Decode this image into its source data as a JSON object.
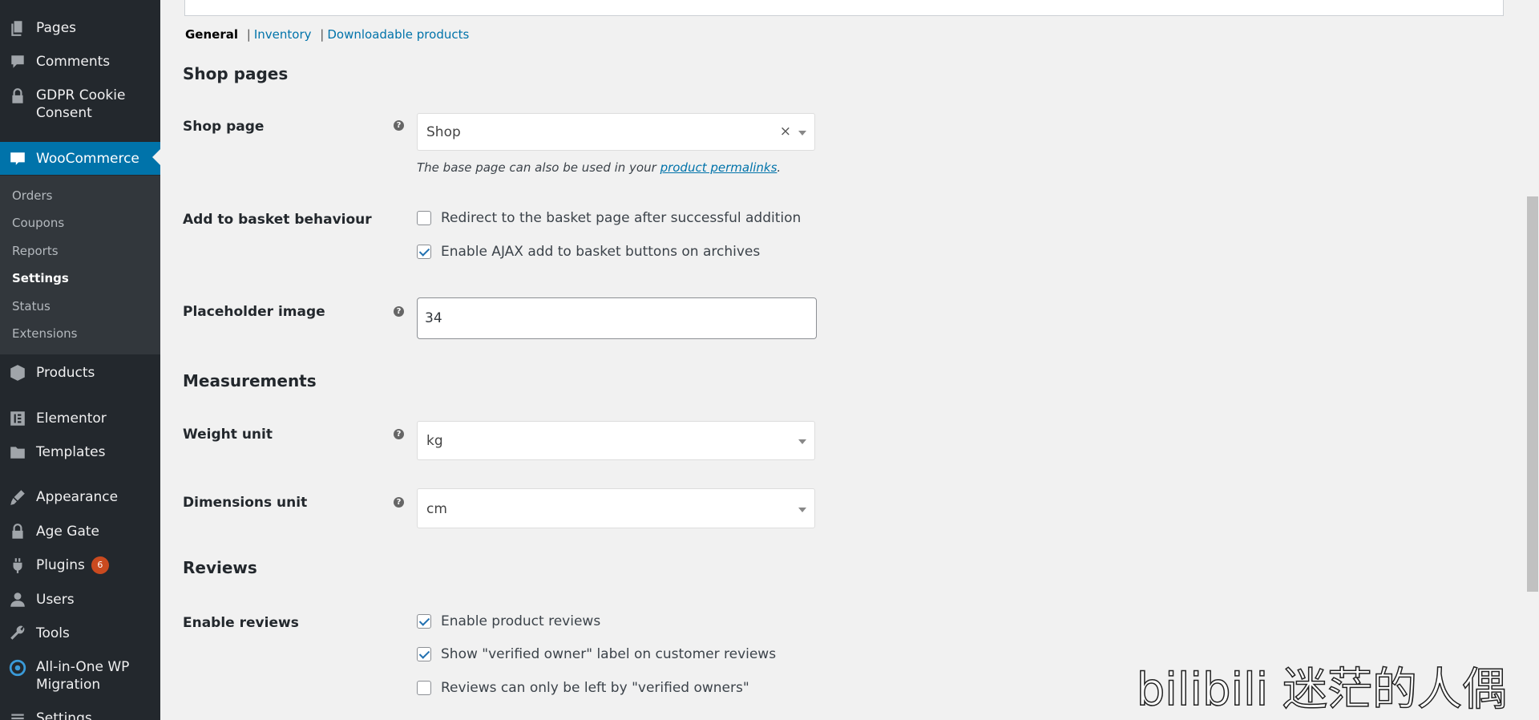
{
  "sidebar": {
    "items": {
      "pages": "Pages",
      "comments": "Comments",
      "gdpr": "GDPR Cookie Consent",
      "woocommerce": "WooCommerce",
      "products": "Products",
      "elementor": "Elementor",
      "templates": "Templates",
      "appearance": "Appearance",
      "age_gate": "Age Gate",
      "plugins": "Plugins",
      "plugins_badge": "6",
      "users": "Users",
      "tools": "Tools",
      "migration": "All-in-One WP Migration",
      "settings": "Settings"
    },
    "woo_submenu": {
      "orders": "Orders",
      "coupons": "Coupons",
      "reports": "Reports",
      "settings": "Settings",
      "status": "Status",
      "extensions": "Extensions"
    }
  },
  "tabs": {
    "general": "General",
    "inventory": "Inventory",
    "downloadable": "Downloadable products",
    "separator": "|"
  },
  "shop_pages": {
    "heading": "Shop pages",
    "shop_page_label": "Shop page",
    "shop_page_value": "Shop",
    "clear_symbol": "×",
    "desc_before": "The base page can also be used in your ",
    "desc_link": "product permalinks",
    "desc_after": ".",
    "basket_label": "Add to basket behaviour",
    "redirect_label": "Redirect to the basket page after successful addition",
    "ajax_label": "Enable AJAX add to basket buttons on archives",
    "placeholder_label": "Placeholder image",
    "placeholder_value": "34"
  },
  "measurements": {
    "heading": "Measurements",
    "weight_label": "Weight unit",
    "weight_value": "kg",
    "dimensions_label": "Dimensions unit",
    "dimensions_value": "cm"
  },
  "reviews": {
    "heading": "Reviews",
    "enable_label": "Enable reviews",
    "product_reviews": "Enable product reviews",
    "verified_label": "Show \"verified owner\" label on customer reviews",
    "verified_only": "Reviews can only be left by \"verified owners\""
  },
  "help_symbol": "?",
  "watermark": "bilibili 迷茫的人偶",
  "colors": {
    "sidebar_bg": "#23282d",
    "accent": "#0073aa",
    "badge": "#ca4a1f",
    "page_bg": "#f1f1f1"
  }
}
